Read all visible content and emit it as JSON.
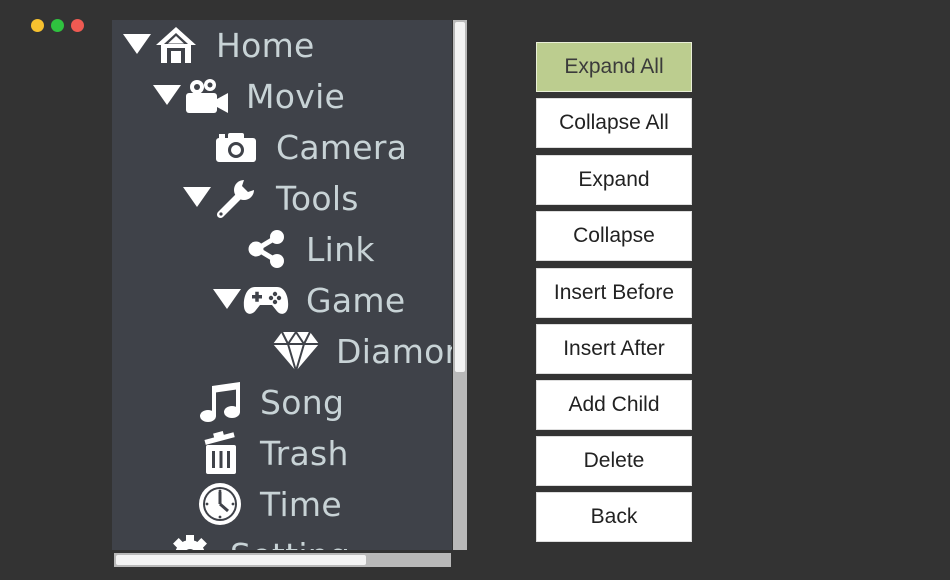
{
  "window": {
    "controls": {
      "close_color": "#f7c12f",
      "minimize_color": "#2fc23f",
      "zoom_color": "#ee5a52"
    }
  },
  "tree": {
    "items": [
      {
        "label": "Home",
        "icon": "home-icon",
        "expanded": true
      },
      {
        "label": "Movie",
        "icon": "video-camera-icon",
        "expanded": true
      },
      {
        "label": "Camera",
        "icon": "camera-icon",
        "expanded": false
      },
      {
        "label": "Tools",
        "icon": "wrench-icon",
        "expanded": true
      },
      {
        "label": "Link",
        "icon": "share-icon",
        "expanded": false
      },
      {
        "label": "Game",
        "icon": "gamepad-icon",
        "expanded": true
      },
      {
        "label": "Diamond",
        "icon": "diamond-icon",
        "expanded": false
      },
      {
        "label": "Song",
        "icon": "music-note-icon",
        "expanded": false
      },
      {
        "label": "Trash",
        "icon": "trash-icon",
        "expanded": false
      },
      {
        "label": "Time",
        "icon": "clock-icon",
        "expanded": false
      },
      {
        "label": "Setting",
        "icon": "gear-icon",
        "expanded": false
      }
    ]
  },
  "buttons": {
    "expand_all": "Expand All",
    "collapse_all": "Collapse All",
    "expand": "Expand",
    "collapse": "Collapse",
    "insert_before": "Insert Before",
    "insert_after": "Insert After",
    "add_child": "Add Child",
    "delete": "Delete",
    "back": "Back"
  },
  "colors": {
    "active_button": "#bccd8f",
    "tree_background": "#3f4249",
    "tree_text": "#c8d3d6"
  }
}
